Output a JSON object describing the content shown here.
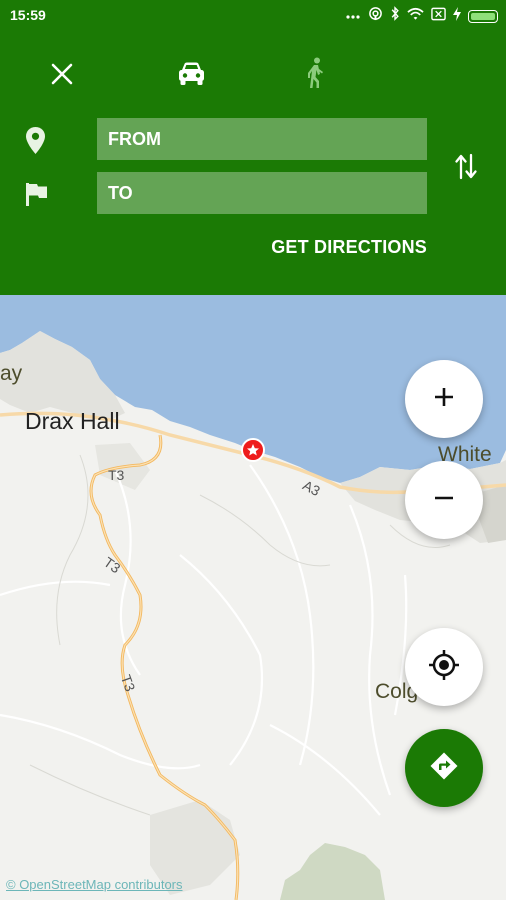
{
  "status_bar": {
    "time": "15:59",
    "icons": [
      "more-dots-icon",
      "hotspot-icon",
      "bluetooth-icon",
      "wifi-icon",
      "sim-off-icon",
      "charging-icon",
      "battery-icon"
    ]
  },
  "header": {
    "modes": [
      "close-icon",
      "car-icon",
      "walk-icon"
    ],
    "from_placeholder": "FROM",
    "to_placeholder": "TO",
    "get_directions_label": "GET DIRECTIONS",
    "accent_color": "#1b7a05"
  },
  "map": {
    "labels": {
      "drax_hall": "Drax Hall",
      "white": "White",
      "bay_fragment": "ay",
      "colg_fragment": "Colg"
    },
    "road_labels": {
      "t3_a": "T3",
      "t3_b": "T3",
      "t3_c": "T3",
      "a3": "A3"
    },
    "attribution": "© OpenStreetMap contributors",
    "controls": [
      "zoom-in-button",
      "zoom-out-button",
      "my-location-button",
      "directions-button"
    ]
  }
}
